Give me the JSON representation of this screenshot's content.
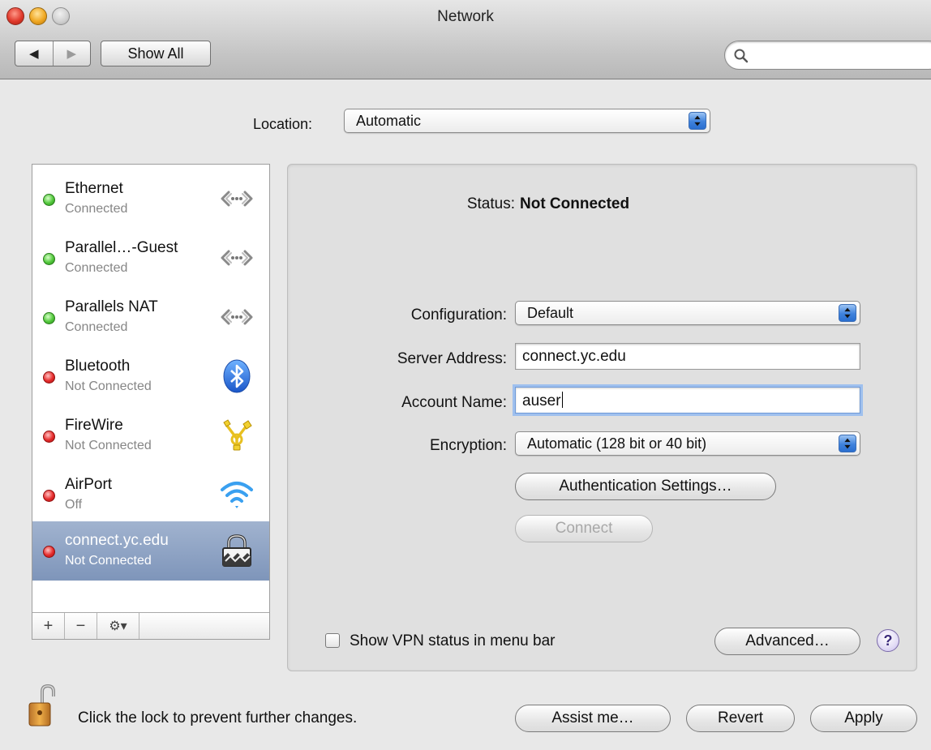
{
  "window": {
    "title": "Network"
  },
  "toolbar": {
    "back_glyph": "◀",
    "forward_glyph": "▶",
    "show_all_label": "Show All",
    "search_placeholder": ""
  },
  "location": {
    "label": "Location:",
    "value": "Automatic"
  },
  "sidebar": {
    "items": [
      {
        "name": "Ethernet",
        "status": "Connected",
        "status_color": "green",
        "icon": "ethernet-icon"
      },
      {
        "name": "Parallel…-Guest",
        "status": "Connected",
        "status_color": "green",
        "icon": "ethernet-icon"
      },
      {
        "name": "Parallels NAT",
        "status": "Connected",
        "status_color": "green",
        "icon": "ethernet-icon"
      },
      {
        "name": "Bluetooth",
        "status": "Not Connected",
        "status_color": "red",
        "icon": "bluetooth-icon"
      },
      {
        "name": "FireWire",
        "status": "Not Connected",
        "status_color": "red",
        "icon": "firewire-icon"
      },
      {
        "name": "AirPort",
        "status": "Off",
        "status_color": "red",
        "icon": "airport-icon"
      },
      {
        "name": "connect.yc.edu",
        "status": "Not Connected",
        "status_color": "red",
        "icon": "vpn-lock-icon",
        "selected": true
      }
    ],
    "add_glyph": "+",
    "remove_glyph": "−",
    "action_glyph": "⚙▾"
  },
  "detail": {
    "status_label": "Status:",
    "status_value": "Not Connected",
    "configuration_label": "Configuration:",
    "configuration_value": "Default",
    "server_address_label": "Server Address:",
    "server_address_value": "connect.yc.edu",
    "account_name_label": "Account Name:",
    "account_name_value": "auser",
    "encryption_label": "Encryption:",
    "encryption_value": "Automatic (128 bit or 40 bit)",
    "auth_settings_label": "Authentication Settings…",
    "connect_label": "Connect",
    "show_vpn_status_label": "Show VPN status in menu bar",
    "show_vpn_status_checked": false,
    "advanced_label": "Advanced…",
    "help_glyph": "?"
  },
  "footer": {
    "lock_text": "Click the lock to prevent further changes.",
    "assist_label": "Assist me…",
    "revert_label": "Revert",
    "apply_label": "Apply"
  },
  "colors": {
    "selection": "#8fa3c4",
    "status_green": "#51c73a",
    "status_red": "#e52a2a",
    "popup_accent": "#3f82dc"
  }
}
